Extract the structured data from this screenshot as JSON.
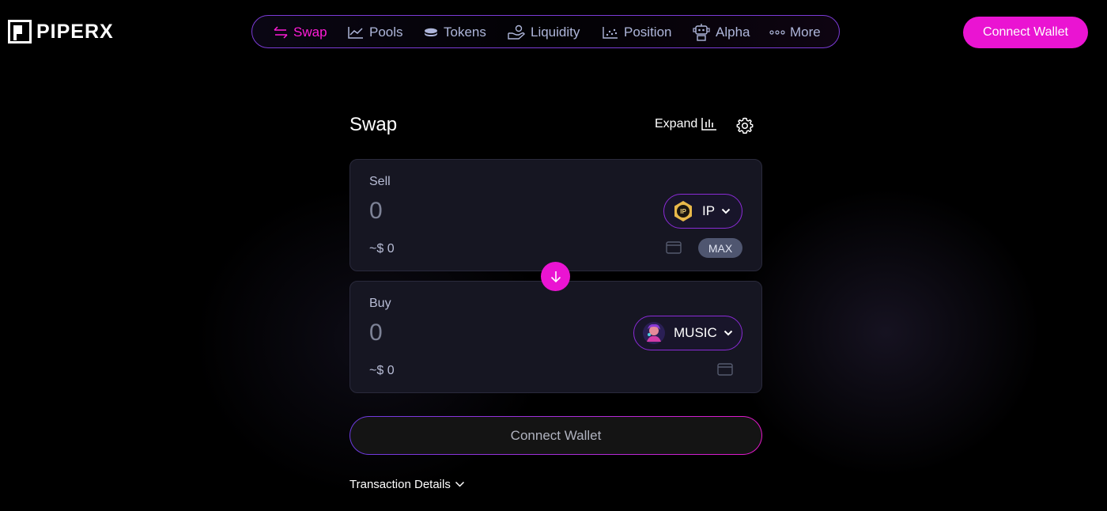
{
  "brand": {
    "name": "PIPERX"
  },
  "nav": {
    "items": [
      {
        "label": "Swap",
        "icon": "swap-arrows-icon",
        "active": true
      },
      {
        "label": "Pools",
        "icon": "chart-line-icon",
        "active": false
      },
      {
        "label": "Tokens",
        "icon": "coin-stack-icon",
        "active": false
      },
      {
        "label": "Liquidity",
        "icon": "hand-coins-icon",
        "active": false
      },
      {
        "label": "Position",
        "icon": "scatter-chart-icon",
        "active": false
      },
      {
        "label": "Alpha",
        "icon": "robot-icon",
        "active": false
      },
      {
        "label": "More",
        "icon": "dots-icon",
        "active": false
      }
    ]
  },
  "header": {
    "connect_wallet_label": "Connect Wallet"
  },
  "swap": {
    "title": "Swap",
    "expand_label": "Expand",
    "sell": {
      "label": "Sell",
      "amount": "0",
      "usd_value": "~$ 0",
      "token": "IP",
      "token_badge": "IP",
      "max_label": "MAX"
    },
    "buy": {
      "label": "Buy",
      "amount": "0",
      "usd_value": "~$ 0",
      "token": "MUSIC"
    },
    "connect_wallet_label": "Connect Wallet",
    "transaction_details_label": "Transaction Details"
  },
  "colors": {
    "accent": "#ea14d2",
    "active_nav": "#ff1cd8",
    "nav_text": "#aeb6da",
    "card_bg": "#161622",
    "border_purple": "#8a2bd6"
  }
}
